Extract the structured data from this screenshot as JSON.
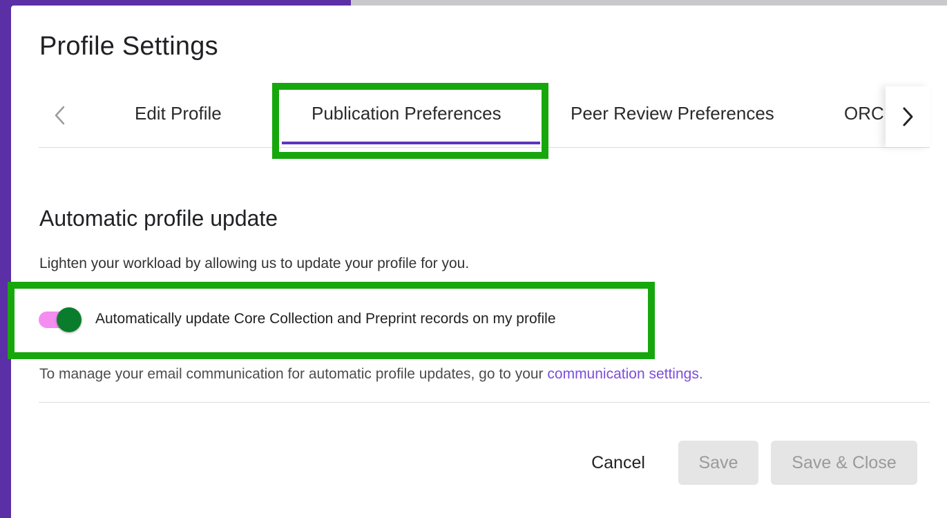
{
  "dialog": {
    "title": "Profile Settings"
  },
  "tabs": {
    "items": [
      {
        "label": "Edit Profile"
      },
      {
        "label": "Publication Preferences",
        "active": true
      },
      {
        "label": "Peer Review Preferences"
      },
      {
        "label": "ORCID"
      }
    ],
    "prev_icon": "chevron-left-icon",
    "next_icon": "chevron-right-icon"
  },
  "section": {
    "title": "Automatic profile update",
    "description": "Lighten your workload by allowing us to update your profile for you."
  },
  "toggle": {
    "label": "Automatically update Core Collection and Preprint records on my profile",
    "checked": true
  },
  "note": {
    "text": "To manage your email communication for automatic profile updates, go to your ",
    "link": "communication settings."
  },
  "footer": {
    "cancel": "Cancel",
    "save": "Save",
    "save_close": "Save & Close"
  },
  "colors": {
    "accent": "#5e33bf",
    "highlight": "#16a70c",
    "toggle_on": "#0a7d2c",
    "toggle_track": "#f58df0",
    "link": "#7c4ddb"
  }
}
